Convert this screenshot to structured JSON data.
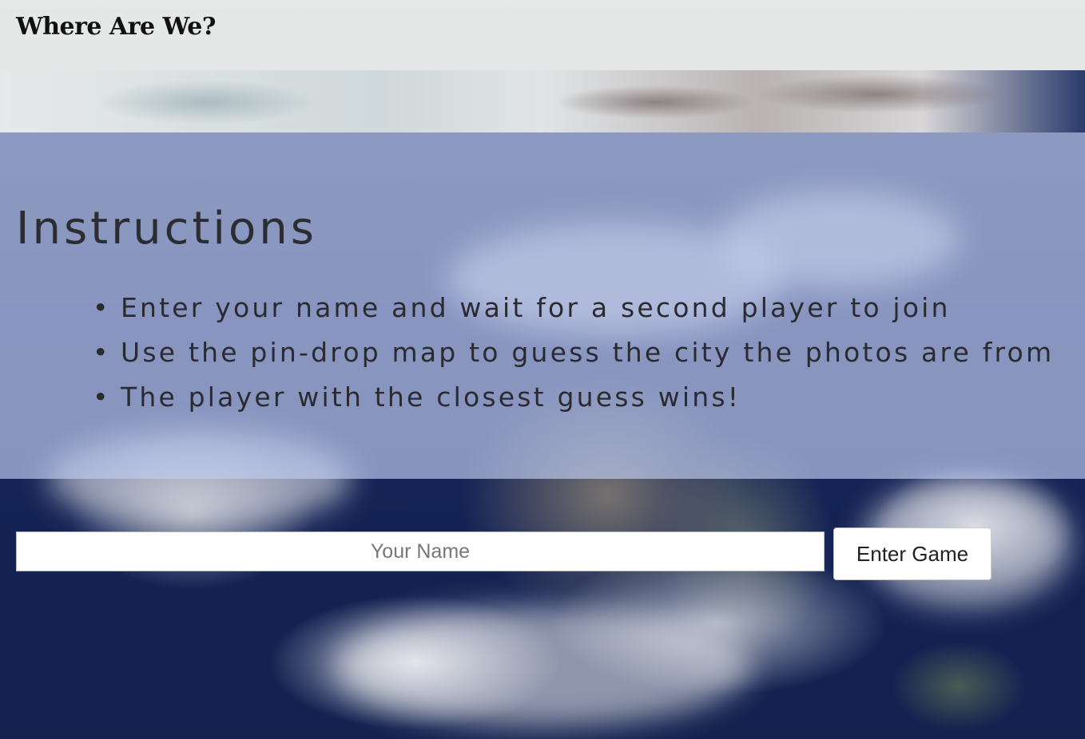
{
  "header": {
    "title": "Where Are We?"
  },
  "instructions": {
    "heading": "Instructions",
    "bullet": "•",
    "items": [
      "Enter your name and wait for a second player to join",
      "Use the pin-drop map to guess the city the photos are from",
      "The player with the closest guess wins!"
    ]
  },
  "join_form": {
    "name_placeholder": "Your Name",
    "name_value": "",
    "submit_label": "Enter Game"
  },
  "colors": {
    "header_bg": "#e8e9e8",
    "panel_bg": "#becef0",
    "ocean": "#13224f"
  }
}
